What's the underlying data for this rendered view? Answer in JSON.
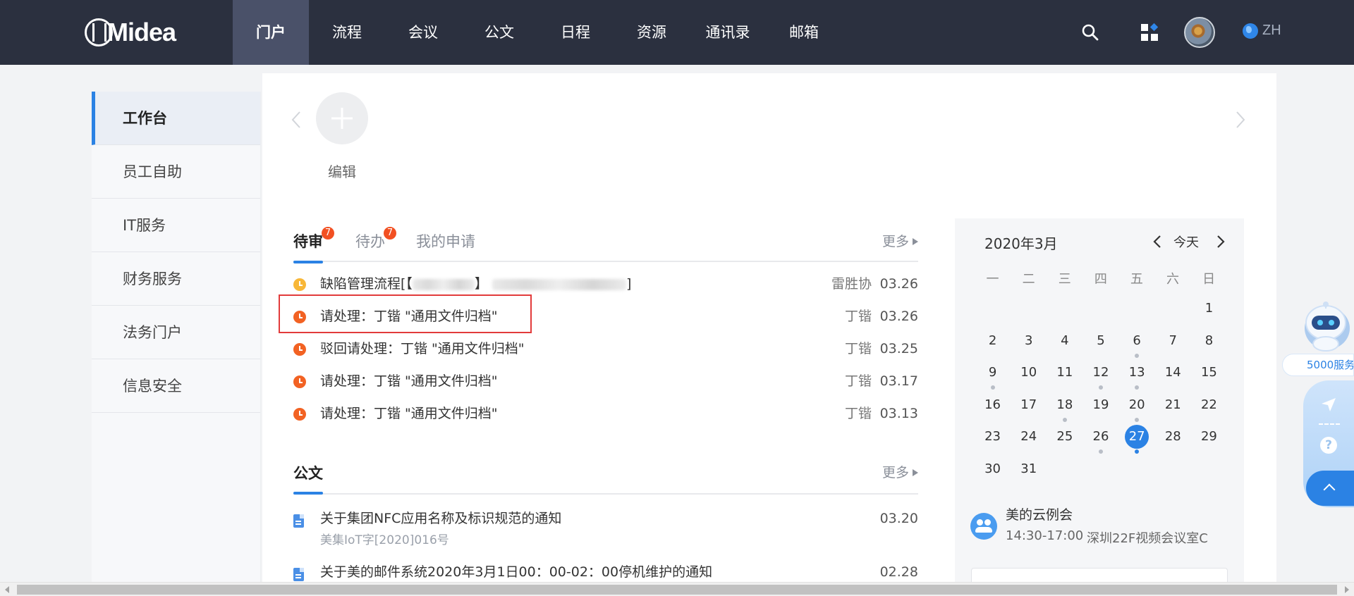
{
  "header": {
    "logo_text": "Midea",
    "nav": [
      {
        "label": "门户",
        "active": true
      },
      {
        "label": "流程"
      },
      {
        "label": "会议"
      },
      {
        "label": "公文"
      },
      {
        "label": "日程"
      },
      {
        "label": "资源"
      },
      {
        "label": "通讯录"
      },
      {
        "label": "邮箱"
      }
    ],
    "search_icon": "search-icon",
    "apps_icon": "apps-grid-icon",
    "language": "ZH"
  },
  "sidebar": {
    "items": [
      {
        "label": "工作台",
        "active": true
      },
      {
        "label": "员工自助"
      },
      {
        "label": "IT服务"
      },
      {
        "label": "财务服务"
      },
      {
        "label": "法务门户"
      },
      {
        "label": "信息安全"
      }
    ]
  },
  "shortcuts": {
    "add_label": "编辑"
  },
  "tasks": {
    "tabs": [
      {
        "label": "待审",
        "badge": "7",
        "active": true
      },
      {
        "label": "待办",
        "badge": "7"
      },
      {
        "label": "我的申请"
      }
    ],
    "more_label": "更多",
    "rows": [
      {
        "title_prefix": "缺陷管理流程[【",
        "title_mid": "】",
        "title_suffix": "]",
        "person": "雷胜协",
        "date": "03.26",
        "icon": "clock-icon",
        "icon_color": "#f8b738"
      },
      {
        "title": "请处理：丁锴 \"通用文件归档\"",
        "person": "丁锴",
        "date": "03.26",
        "icon": "clock-icon",
        "icon_color": "#f26223"
      },
      {
        "title": "驳回请处理：丁锴 \"通用文件归档\"",
        "person": "丁锴",
        "date": "03.25",
        "icon": "clock-icon",
        "icon_color": "#f26223"
      },
      {
        "title": "请处理：丁锴 \"通用文件归档\"",
        "person": "丁锴",
        "date": "03.17",
        "icon": "clock-icon",
        "icon_color": "#f26223"
      },
      {
        "title": "请处理：丁锴 \"通用文件归档\"",
        "person": "丁锴",
        "date": "03.13",
        "icon": "clock-icon",
        "icon_color": "#f26223"
      }
    ]
  },
  "documents": {
    "tab_label": "公文",
    "more_label": "更多",
    "rows": [
      {
        "title": "关于集团NFC应用名称及标识规范的通知",
        "sub": "美集IoT字[2020]016号",
        "date": "03.20"
      },
      {
        "title": "关于美的邮件系统2020年3月1日00：00-02：00停机维护的通知",
        "sub": "",
        "date": "02.28"
      }
    ]
  },
  "calendar": {
    "title": "2020年3月",
    "today_label": "今天",
    "weekdays": [
      "一",
      "二",
      "三",
      "四",
      "五",
      "六",
      "日"
    ],
    "first_weekday_index": 6,
    "days_in_month": 31,
    "selected_day": 27,
    "event_days": [
      6,
      9,
      12,
      13,
      18,
      20,
      26,
      27
    ]
  },
  "event": {
    "title": "美的云例会",
    "time": "14:30-17:00",
    "room": "深圳22F视频会议室C"
  },
  "floating": {
    "service_label": "5000服务"
  },
  "colors": {
    "accent": "#2b82e4",
    "nav_bg": "#2b303f",
    "badge": "#f25022",
    "highlight": "#e23b3b"
  }
}
